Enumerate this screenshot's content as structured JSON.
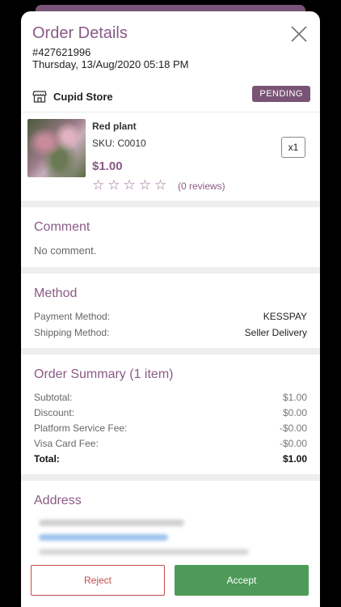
{
  "header": {
    "title": "Order Details",
    "order_number": "#427621996",
    "order_date": "Thursday, 13/Aug/2020 05:18 PM"
  },
  "store": {
    "name": "Cupid Store",
    "status": "PENDING",
    "icon": "store-icon"
  },
  "product": {
    "name": "Red plant",
    "sku": "SKU: C0010",
    "price": "$1.00",
    "quantity": "x1",
    "rating": 0,
    "reviews": "(0 reviews)"
  },
  "comment": {
    "title": "Comment",
    "text": "No comment."
  },
  "method": {
    "title": "Method",
    "payment_label": "Payment Method:",
    "payment_value": "KESSPAY",
    "shipping_label": "Shipping Method:",
    "shipping_value": "Seller Delivery"
  },
  "summary": {
    "title": "Order Summary (1 item)",
    "rows": [
      {
        "label": "Subtotal:",
        "value": "$1.00"
      },
      {
        "label": "Discount:",
        "value": "$0.00"
      },
      {
        "label": "Platform Service Fee:",
        "value": "-$0.00"
      },
      {
        "label": "Visa Card Fee:",
        "value": "-$0.00"
      }
    ],
    "total_label": "Total:",
    "total_value": "$1.00"
  },
  "address": {
    "title": "Address"
  },
  "actions": {
    "reject": "Reject",
    "accept": "Accept"
  },
  "colors": {
    "accent": "#8a5a86",
    "badge": "#7a5476",
    "accept": "#4e9a59",
    "reject": "#c44a4a"
  }
}
